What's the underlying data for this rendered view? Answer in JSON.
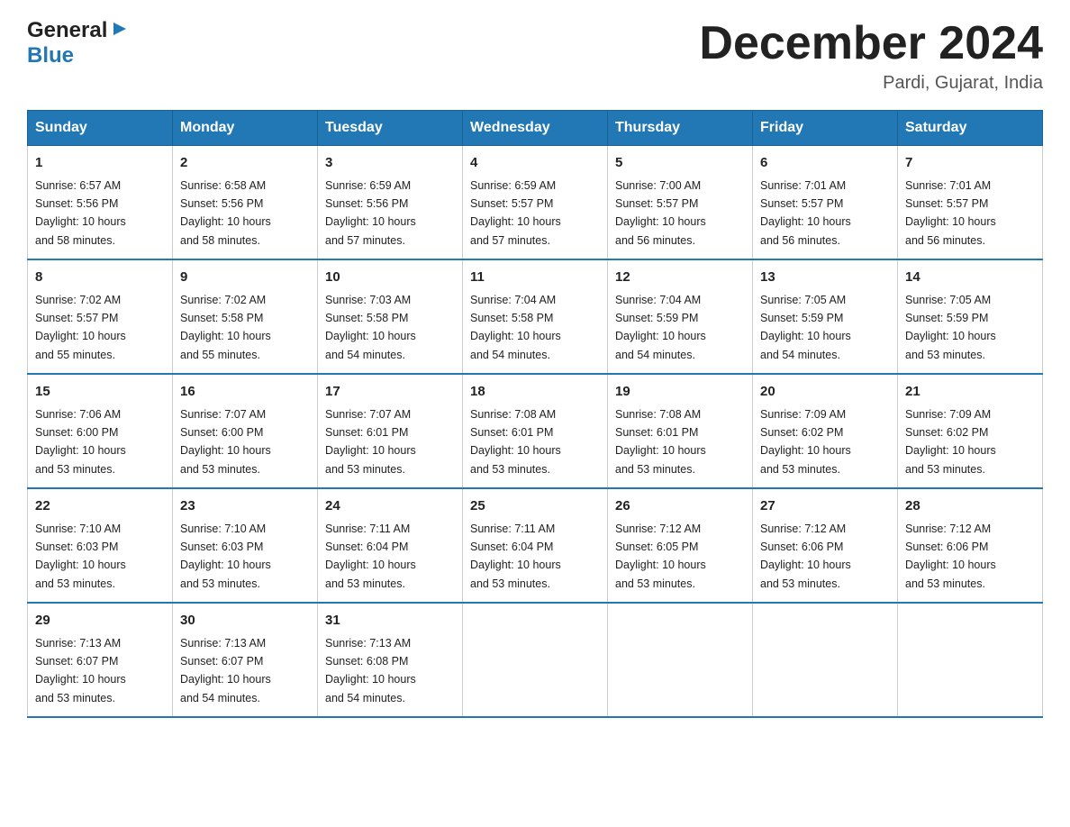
{
  "logo": {
    "general": "General",
    "arrow": "▶",
    "blue": "Blue"
  },
  "title": "December 2024",
  "location": "Pardi, Gujarat, India",
  "days_header": [
    "Sunday",
    "Monday",
    "Tuesday",
    "Wednesday",
    "Thursday",
    "Friday",
    "Saturday"
  ],
  "weeks": [
    [
      {
        "day": "1",
        "sunrise": "6:57 AM",
        "sunset": "5:56 PM",
        "daylight": "10 hours and 58 minutes."
      },
      {
        "day": "2",
        "sunrise": "6:58 AM",
        "sunset": "5:56 PM",
        "daylight": "10 hours and 58 minutes."
      },
      {
        "day": "3",
        "sunrise": "6:59 AM",
        "sunset": "5:56 PM",
        "daylight": "10 hours and 57 minutes."
      },
      {
        "day": "4",
        "sunrise": "6:59 AM",
        "sunset": "5:57 PM",
        "daylight": "10 hours and 57 minutes."
      },
      {
        "day": "5",
        "sunrise": "7:00 AM",
        "sunset": "5:57 PM",
        "daylight": "10 hours and 56 minutes."
      },
      {
        "day": "6",
        "sunrise": "7:01 AM",
        "sunset": "5:57 PM",
        "daylight": "10 hours and 56 minutes."
      },
      {
        "day": "7",
        "sunrise": "7:01 AM",
        "sunset": "5:57 PM",
        "daylight": "10 hours and 56 minutes."
      }
    ],
    [
      {
        "day": "8",
        "sunrise": "7:02 AM",
        "sunset": "5:57 PM",
        "daylight": "10 hours and 55 minutes."
      },
      {
        "day": "9",
        "sunrise": "7:02 AM",
        "sunset": "5:58 PM",
        "daylight": "10 hours and 55 minutes."
      },
      {
        "day": "10",
        "sunrise": "7:03 AM",
        "sunset": "5:58 PM",
        "daylight": "10 hours and 54 minutes."
      },
      {
        "day": "11",
        "sunrise": "7:04 AM",
        "sunset": "5:58 PM",
        "daylight": "10 hours and 54 minutes."
      },
      {
        "day": "12",
        "sunrise": "7:04 AM",
        "sunset": "5:59 PM",
        "daylight": "10 hours and 54 minutes."
      },
      {
        "day": "13",
        "sunrise": "7:05 AM",
        "sunset": "5:59 PM",
        "daylight": "10 hours and 54 minutes."
      },
      {
        "day": "14",
        "sunrise": "7:05 AM",
        "sunset": "5:59 PM",
        "daylight": "10 hours and 53 minutes."
      }
    ],
    [
      {
        "day": "15",
        "sunrise": "7:06 AM",
        "sunset": "6:00 PM",
        "daylight": "10 hours and 53 minutes."
      },
      {
        "day": "16",
        "sunrise": "7:07 AM",
        "sunset": "6:00 PM",
        "daylight": "10 hours and 53 minutes."
      },
      {
        "day": "17",
        "sunrise": "7:07 AM",
        "sunset": "6:01 PM",
        "daylight": "10 hours and 53 minutes."
      },
      {
        "day": "18",
        "sunrise": "7:08 AM",
        "sunset": "6:01 PM",
        "daylight": "10 hours and 53 minutes."
      },
      {
        "day": "19",
        "sunrise": "7:08 AM",
        "sunset": "6:01 PM",
        "daylight": "10 hours and 53 minutes."
      },
      {
        "day": "20",
        "sunrise": "7:09 AM",
        "sunset": "6:02 PM",
        "daylight": "10 hours and 53 minutes."
      },
      {
        "day": "21",
        "sunrise": "7:09 AM",
        "sunset": "6:02 PM",
        "daylight": "10 hours and 53 minutes."
      }
    ],
    [
      {
        "day": "22",
        "sunrise": "7:10 AM",
        "sunset": "6:03 PM",
        "daylight": "10 hours and 53 minutes."
      },
      {
        "day": "23",
        "sunrise": "7:10 AM",
        "sunset": "6:03 PM",
        "daylight": "10 hours and 53 minutes."
      },
      {
        "day": "24",
        "sunrise": "7:11 AM",
        "sunset": "6:04 PM",
        "daylight": "10 hours and 53 minutes."
      },
      {
        "day": "25",
        "sunrise": "7:11 AM",
        "sunset": "6:04 PM",
        "daylight": "10 hours and 53 minutes."
      },
      {
        "day": "26",
        "sunrise": "7:12 AM",
        "sunset": "6:05 PM",
        "daylight": "10 hours and 53 minutes."
      },
      {
        "day": "27",
        "sunrise": "7:12 AM",
        "sunset": "6:06 PM",
        "daylight": "10 hours and 53 minutes."
      },
      {
        "day": "28",
        "sunrise": "7:12 AM",
        "sunset": "6:06 PM",
        "daylight": "10 hours and 53 minutes."
      }
    ],
    [
      {
        "day": "29",
        "sunrise": "7:13 AM",
        "sunset": "6:07 PM",
        "daylight": "10 hours and 53 minutes."
      },
      {
        "day": "30",
        "sunrise": "7:13 AM",
        "sunset": "6:07 PM",
        "daylight": "10 hours and 54 minutes."
      },
      {
        "day": "31",
        "sunrise": "7:13 AM",
        "sunset": "6:08 PM",
        "daylight": "10 hours and 54 minutes."
      },
      null,
      null,
      null,
      null
    ]
  ],
  "labels": {
    "sunrise": "Sunrise:",
    "sunset": "Sunset:",
    "daylight": "Daylight:"
  }
}
